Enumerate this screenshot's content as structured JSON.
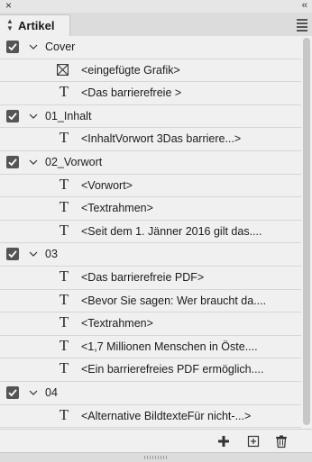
{
  "panel": {
    "tab_label": "Artikel"
  },
  "rows": [
    {
      "type": "group",
      "label": "Cover",
      "checked": true
    },
    {
      "type": "item",
      "icon": "graphic",
      "label": "<eingefügte Grafik>"
    },
    {
      "type": "item",
      "icon": "text",
      "label": "<Das barrierefreie >"
    },
    {
      "type": "group",
      "label": "01_Inhalt",
      "checked": true
    },
    {
      "type": "item",
      "icon": "text",
      "label": "<InhaltVorwort 3Das barriere...>"
    },
    {
      "type": "group",
      "label": "02_Vorwort",
      "checked": true
    },
    {
      "type": "item",
      "icon": "text",
      "label": "<Vorwort>"
    },
    {
      "type": "item",
      "icon": "text",
      "label": "<Textrahmen>"
    },
    {
      "type": "item",
      "icon": "text",
      "label": "<Seit dem 1. Jänner 2016 gilt das...."
    },
    {
      "type": "group",
      "label": "03",
      "checked": true
    },
    {
      "type": "item",
      "icon": "text",
      "label": "<Das barrierefreie PDF>"
    },
    {
      "type": "item",
      "icon": "text",
      "label": "<Bevor Sie sagen: Wer braucht da...."
    },
    {
      "type": "item",
      "icon": "text",
      "label": "<Textrahmen>"
    },
    {
      "type": "item",
      "icon": "text",
      "label": "<1,7  Millionen Menschen in Öste...."
    },
    {
      "type": "item",
      "icon": "text",
      "label": "<Ein barrierefreies PDF ermöglich...."
    },
    {
      "type": "group",
      "label": "04",
      "checked": true
    },
    {
      "type": "item",
      "icon": "text",
      "label": "<Alternative BildtexteFür nicht-...>"
    }
  ],
  "icons": {
    "text_glyph": "T"
  }
}
